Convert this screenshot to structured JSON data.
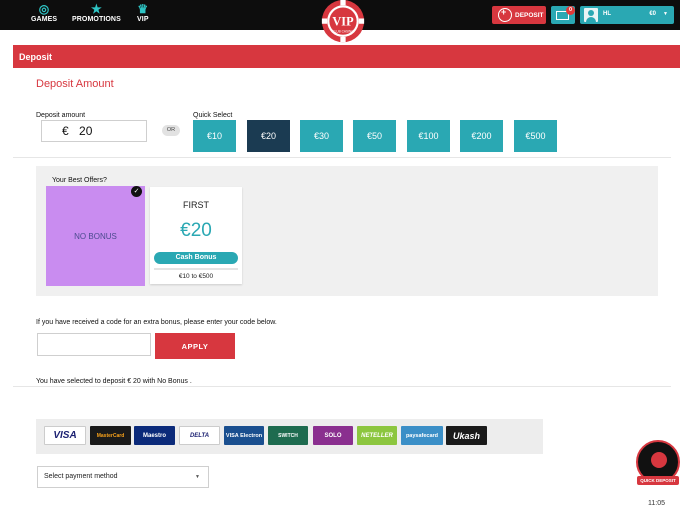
{
  "nav": {
    "games_label": "GAMES",
    "promotions_label": "PROMOTIONS",
    "vip_label": "VIP"
  },
  "logo": {
    "text": "VIP",
    "subtext": "CLUB CASINO"
  },
  "header": {
    "deposit_label": "DEPOSIT",
    "mail_count": "0",
    "username": "HL",
    "balance": "€0"
  },
  "page": {
    "bar_title": "Deposit",
    "section_title": "Deposit Amount"
  },
  "amount": {
    "label": "Deposit amount",
    "currency": "€",
    "value": "20",
    "or_label": "OR"
  },
  "quick_select": {
    "label": "Quick Select",
    "options": [
      "€10",
      "€20",
      "€30",
      "€50",
      "€100",
      "€200",
      "€500"
    ],
    "selected": "€20"
  },
  "offers": {
    "title": "Your Best Offers?",
    "no_bonus_label": "NO BONUS",
    "check_glyph": "✓",
    "card": {
      "name": "FIRST",
      "amount": "€20",
      "type": "Cash Bonus",
      "range": "€10 to €500"
    }
  },
  "bonus_code": {
    "prompt": "If you have received a code for an extra bonus, please enter your code below.",
    "input_value": "",
    "apply_label": "APPLY"
  },
  "summary": "You have selected to deposit € 20  with  No Bonus .",
  "payment_methods": [
    "VISA",
    "MasterCard",
    "Maestro",
    "DELTA",
    "VISA Electron",
    "SWITCH",
    "SOLO",
    "NETELLER",
    "paysafecard",
    "Ukash"
  ],
  "payment_select": {
    "value": "Select payment method"
  },
  "quick_deposit_label": "QUICK DEPOSIT",
  "clock": "11:05",
  "colors": {
    "accent_red": "#d7373f",
    "teal": "#2aa8b3",
    "dark_navy": "#1b3b52",
    "no_bonus_purple": "#c98cf0"
  }
}
